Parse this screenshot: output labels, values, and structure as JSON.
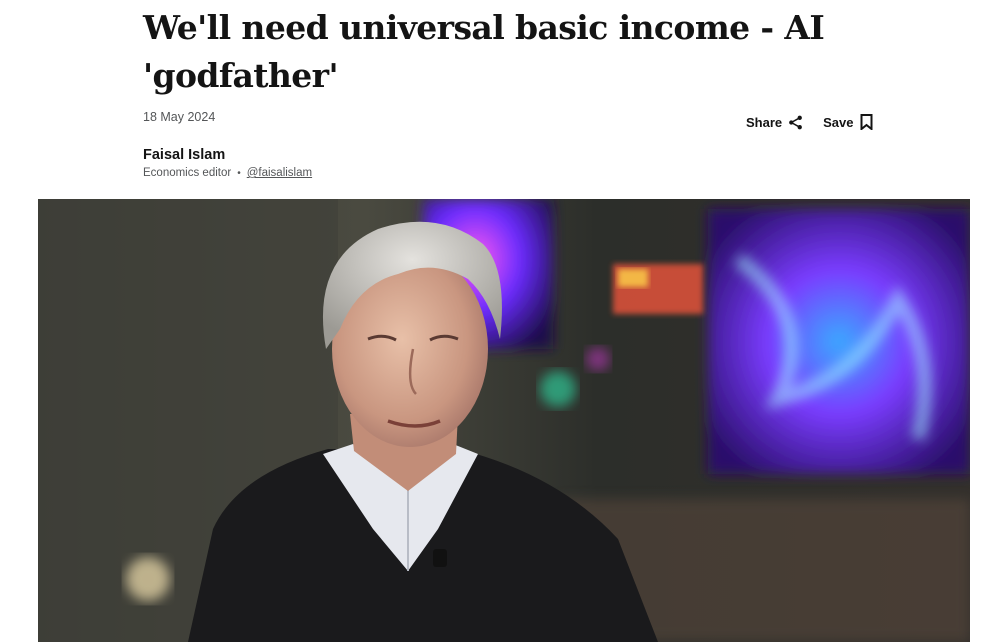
{
  "article": {
    "headline": "We'll need universal basic income - AI 'godfather'",
    "date": "18 May 2024"
  },
  "actions": {
    "share_label": "Share",
    "save_label": "Save"
  },
  "author": {
    "name": "Faisal Islam",
    "role": "Economics editor",
    "separator": "•",
    "handle": "@faisalislam"
  },
  "hero_image": {
    "description_icon": "photo"
  }
}
